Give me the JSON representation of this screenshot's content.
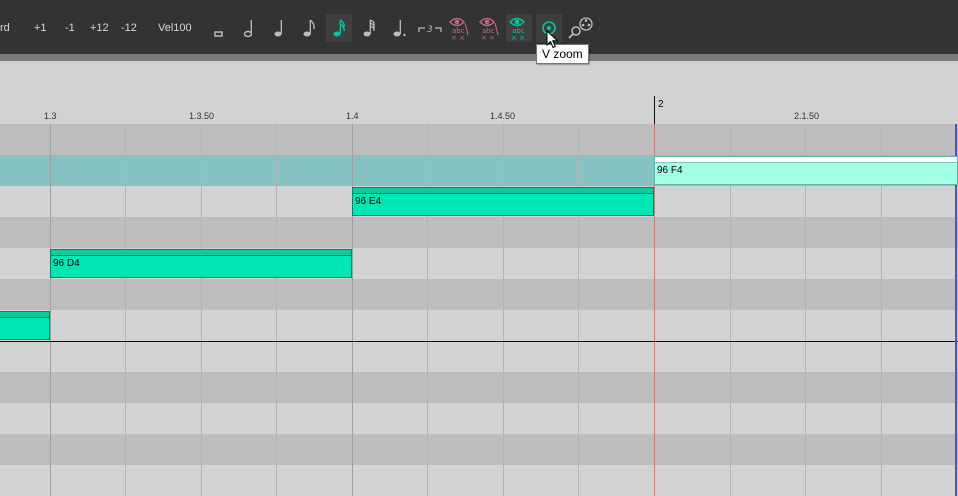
{
  "toolbar": {
    "left_text": "rd",
    "transpose_up_1": "+1",
    "transpose_down_1": "-1",
    "transpose_up_12": "+12",
    "transpose_down_12": "-12",
    "velocity": "Vel100",
    "buttons": [
      "whole-note-icon",
      "half-note-icon",
      "quarter-note-icon",
      "eighth-note-icon",
      "sixteenth-note-icon",
      "thirtysecond-note-icon",
      "dotted-note-icon",
      "tuplet-icon",
      "hide-note-names-icon",
      "hide-velocity-icon",
      "show-note-names-icon",
      "v-zoom-icon",
      "h-zoom-icon"
    ],
    "active_note_length": "sixteenth-note-icon",
    "accent_color": "#00c8a0"
  },
  "tooltip": {
    "text": "V zoom"
  },
  "ruler": {
    "labels": [
      {
        "text": "1.3",
        "kind": "beat"
      },
      {
        "text": "1.3.50",
        "kind": "sub"
      },
      {
        "text": "1.4",
        "kind": "beat"
      },
      {
        "text": "1.4.50",
        "kind": "sub"
      },
      {
        "text": "2",
        "kind": "bar"
      },
      {
        "text": "2.1.50",
        "kind": "sub"
      }
    ]
  },
  "notes": [
    {
      "label": "",
      "velocity": 96,
      "pitch": "C4"
    },
    {
      "label": "96 D4",
      "velocity": 96,
      "pitch": "D4"
    },
    {
      "label": "96 E4",
      "velocity": 96,
      "pitch": "E4"
    },
    {
      "label": "96 F4",
      "velocity": 96,
      "pitch": "F4",
      "selected": true
    }
  ],
  "colors": {
    "note_fill": "#00e6b4",
    "note_selected": "#a2ffe6",
    "highlight_row": "#85c3c3",
    "bar_line": "#c08080",
    "end_marker": "#3355ff"
  }
}
